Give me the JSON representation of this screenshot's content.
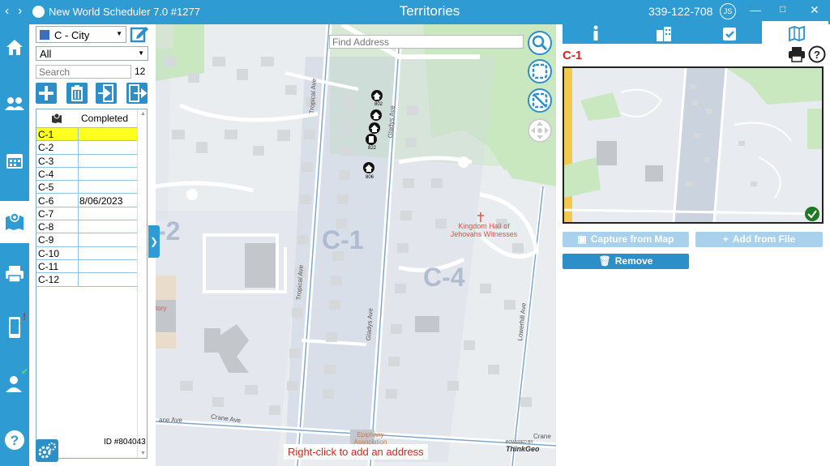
{
  "titlebar": {
    "app_name": "New World Scheduler 7.0 #1277",
    "title": "Territories",
    "congregation_id": "339-122-708",
    "user_initials": "JS"
  },
  "sidebar": {
    "items": [
      {
        "icon": "home-icon"
      },
      {
        "icon": "people-icon"
      },
      {
        "icon": "calendar-icon"
      },
      {
        "icon": "map-icon",
        "active": true
      },
      {
        "icon": "printer-icon"
      },
      {
        "icon": "mobile-alert-icon",
        "badge": "!"
      },
      {
        "icon": "user-check-icon"
      },
      {
        "icon": "help-icon"
      }
    ]
  },
  "panel": {
    "territory_type": "C - City",
    "filter": "All",
    "search_placeholder": "Search",
    "count": "12",
    "columns": [
      "",
      "Completed"
    ],
    "rows": [
      {
        "name": "C-1",
        "completed": ""
      },
      {
        "name": "C-2",
        "completed": ""
      },
      {
        "name": "C-3",
        "completed": ""
      },
      {
        "name": "C-4",
        "completed": ""
      },
      {
        "name": "C-5",
        "completed": ""
      },
      {
        "name": "C-6",
        "completed": "8/06/2023"
      },
      {
        "name": "C-7",
        "completed": ""
      },
      {
        "name": "C-8",
        "completed": ""
      },
      {
        "name": "C-9",
        "completed": ""
      },
      {
        "name": "C-10",
        "completed": ""
      },
      {
        "name": "C-11",
        "completed": ""
      },
      {
        "name": "C-12",
        "completed": ""
      }
    ],
    "id_label": "ID #804043"
  },
  "map": {
    "find_placeholder": "Find Address",
    "hint": "Right-click to add an address",
    "labels": {
      "territory_c1": "C-1",
      "territory_c2": "-2",
      "territory_c4": "C-4",
      "kingdom_hall": "Kingdom Hall of Jehovahs Witnesses",
      "street_tropical_1": "Tropical Ave",
      "street_tropical_2": "Tropical Ave",
      "street_gladys_1": "Gladys Ave",
      "street_gladys_2": "Gladys Ave",
      "street_lowerhill": "Lowerhill Ave",
      "street_crane_1": "Crane Ave",
      "street_crane_2": "ane Ave",
      "street_crane_3": "Crane",
      "church": "Epiphany Association",
      "partial_label": "tory",
      "house_802": "802",
      "house_822": "822",
      "house_806": "806",
      "powered_by": "POWERED BY",
      "thinkgeo": "ThinkGeo"
    }
  },
  "detail": {
    "territory_name": "C-1",
    "capture_label": "Capture from Map",
    "add_file_label": "Add from File",
    "remove_label": "Remove"
  },
  "colors": {
    "accent": "#2e9bd2",
    "selected_row": "#ffff20",
    "alert": "#e02020"
  }
}
